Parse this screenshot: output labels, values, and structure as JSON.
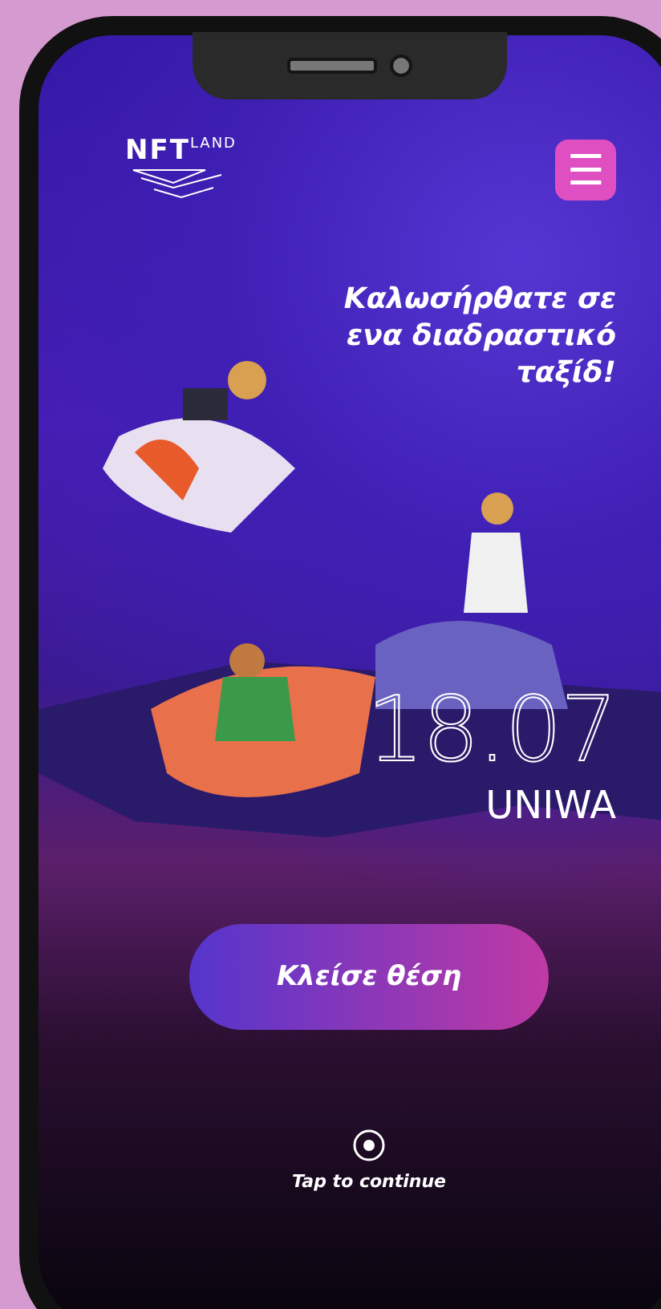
{
  "logo": {
    "main": "NFT",
    "sup": "LAND"
  },
  "menu_button": {
    "icon": "☰"
  },
  "headline": "Καλωσήρθατε σε ενα διαδραστικό ταξίδ!",
  "event": {
    "date": "18.07",
    "venue": "UNIWA"
  },
  "cta_button": {
    "label": "Κλείσε θέση"
  },
  "tap_hint": {
    "label": "Tap to continue"
  }
}
